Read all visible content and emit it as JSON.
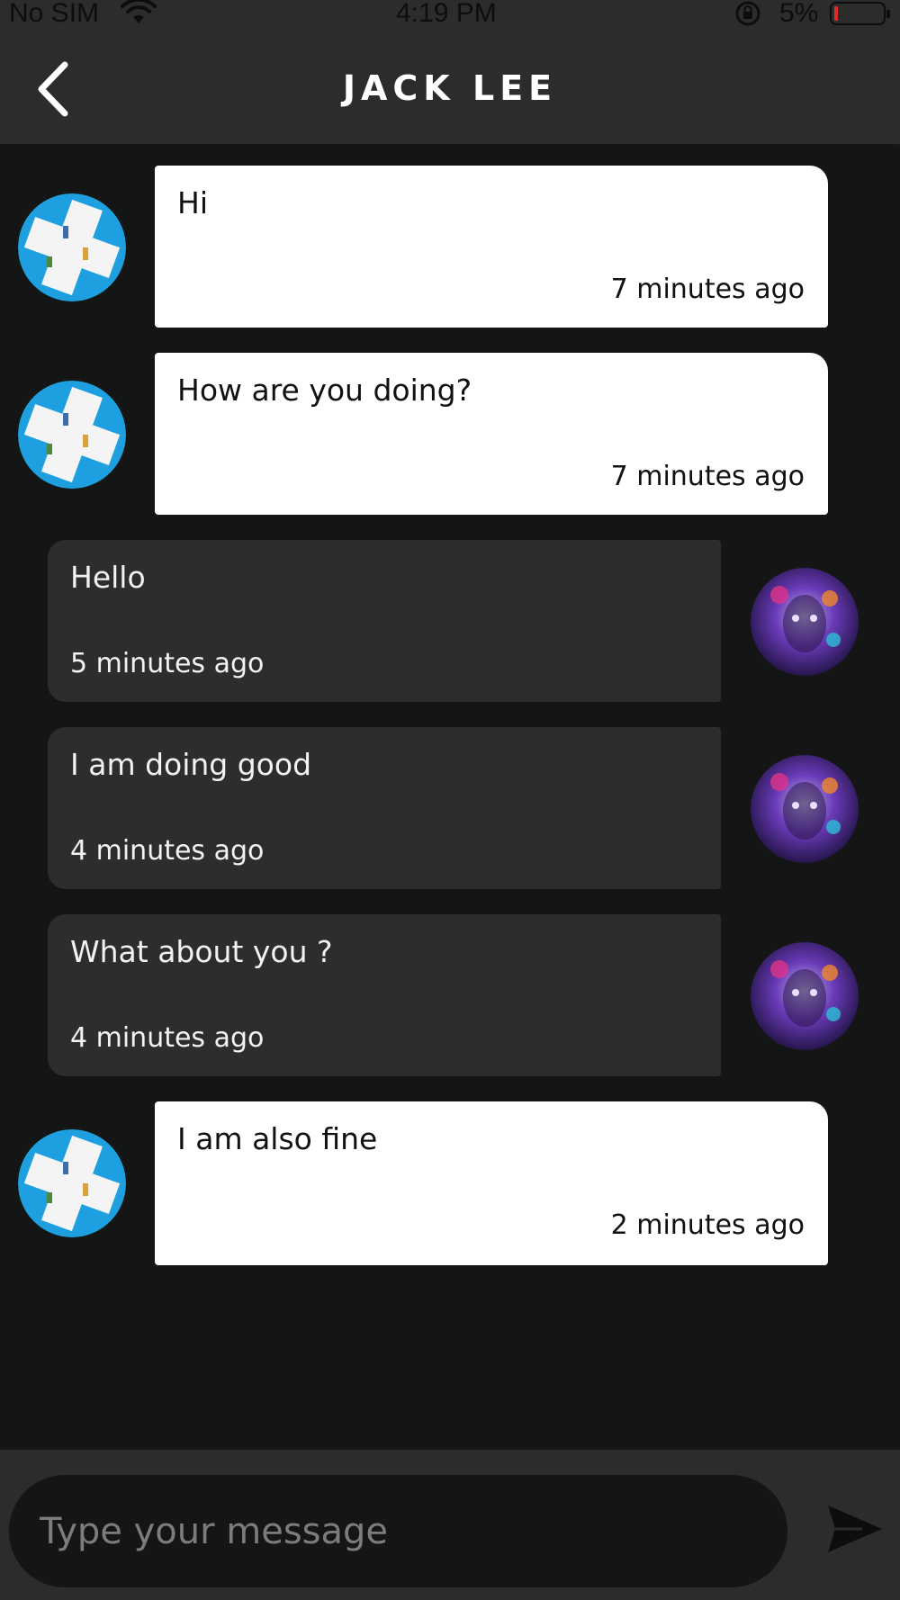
{
  "status_bar": {
    "carrier": "No SIM",
    "time": "4:19 PM",
    "battery": "5%",
    "battery_level": 0.05,
    "battery_color": "#e02a2a"
  },
  "header": {
    "title": "JACK LEE",
    "back_icon": "chevron-left-icon"
  },
  "messages": [
    {
      "direction": "incoming",
      "text": "Hi",
      "time": "7 minutes ago"
    },
    {
      "direction": "incoming",
      "text": "How are you doing?",
      "time": "7 minutes ago"
    },
    {
      "direction": "outgoing",
      "text": "Hello",
      "time": "5 minutes ago"
    },
    {
      "direction": "outgoing",
      "text": "I am doing good",
      "time": "4 minutes ago"
    },
    {
      "direction": "outgoing",
      "text": "What about you ?",
      "time": "4 minutes ago"
    },
    {
      "direction": "incoming",
      "text": "I am also fine",
      "time": "2 minutes ago"
    }
  ],
  "composer": {
    "placeholder": "Type your message",
    "value": "",
    "send_icon": "send-icon"
  },
  "colors": {
    "background": "#141615",
    "header": "#2b2d2d",
    "incoming_bubble": "#ffffff",
    "outgoing_bubble": "#2c2e2e"
  }
}
